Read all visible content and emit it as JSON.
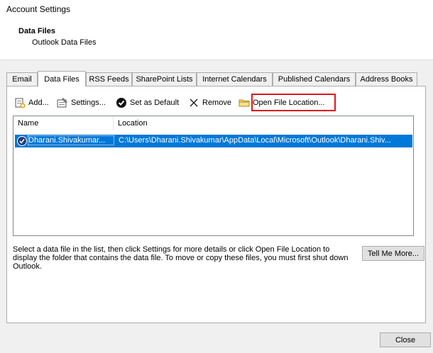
{
  "window": {
    "title": "Account Settings"
  },
  "header": {
    "title": "Data Files",
    "subtitle": "Outlook Data Files"
  },
  "tabs": [
    {
      "label": "Email"
    },
    {
      "label": "Data Files",
      "active": true
    },
    {
      "label": "RSS Feeds"
    },
    {
      "label": "SharePoint Lists"
    },
    {
      "label": "Internet Calendars"
    },
    {
      "label": "Published Calendars"
    },
    {
      "label": "Address Books"
    }
  ],
  "toolbar": {
    "add": "Add...",
    "settings": "Settings...",
    "set_default": "Set as Default",
    "remove": "Remove",
    "open_location": "Open File Location..."
  },
  "list": {
    "columns": [
      "Name",
      "Location"
    ],
    "rows": [
      {
        "name": "Dharani.Shivakumar...",
        "location": "C:\\Users\\Dharani.Shivakumar\\AppData\\Local\\Microsoft\\Outlook\\Dharani.Shiv..."
      }
    ]
  },
  "description": "Select a data file in the list, then click Settings for more details or click Open File Location to display the folder that contains the data file. To move or copy these files, you must first shut down Outlook.",
  "buttons": {
    "tell_me_more": "Tell Me More...",
    "close": "Close"
  },
  "colors": {
    "selection": "#0078d7",
    "highlight_box": "#e0161b"
  }
}
